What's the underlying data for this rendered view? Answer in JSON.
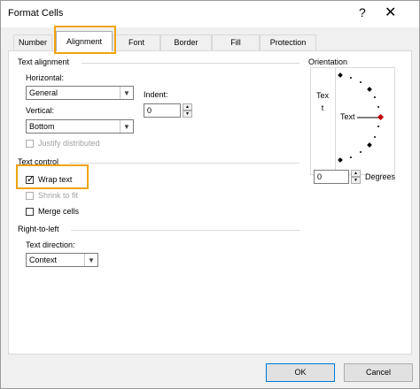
{
  "window": {
    "title": "Format Cells",
    "help_label": "?",
    "close_label": "✕"
  },
  "tabs": [
    {
      "label": "Number"
    },
    {
      "label": "Alignment",
      "active": true
    },
    {
      "label": "Font"
    },
    {
      "label": "Border"
    },
    {
      "label": "Fill"
    },
    {
      "label": "Protection"
    }
  ],
  "text_alignment": {
    "section_label": "Text alignment",
    "horizontal_label": "Horizontal:",
    "horizontal_value": "General",
    "indent_label": "Indent:",
    "indent_value": "0",
    "vertical_label": "Vertical:",
    "vertical_value": "Bottom",
    "justify_label": "Justify distributed"
  },
  "orientation": {
    "section_label": "Orientation",
    "vertical_text": "Text",
    "dial_text": "Text",
    "degrees_value": "0",
    "degrees_label": "Degrees"
  },
  "text_control": {
    "section_label": "Text control",
    "wrap_text_label": "Wrap text",
    "wrap_text_checked": true,
    "shrink_label": "Shrink to fit",
    "merge_label": "Merge cells"
  },
  "rtl": {
    "section_label": "Right-to-left",
    "direction_label": "Text direction:",
    "direction_value": "Context"
  },
  "buttons": {
    "ok_label": "OK",
    "cancel_label": "Cancel"
  },
  "colors": {
    "highlight": "#f0a30a",
    "accent": "#0078d7",
    "dial_red": "#c00000"
  }
}
